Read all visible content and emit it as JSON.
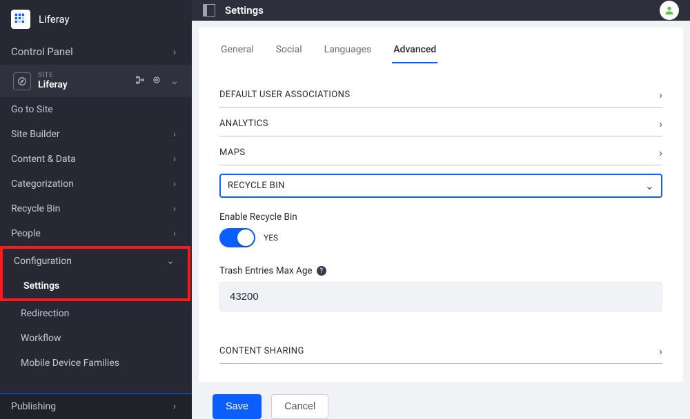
{
  "brand": {
    "name": "Liferay"
  },
  "sidebar": {
    "control_panel": "Control Panel",
    "site": {
      "kicker": "SITE",
      "name": "Liferay"
    },
    "go_to_site": "Go to Site",
    "items": [
      {
        "label": "Site Builder"
      },
      {
        "label": "Content & Data"
      },
      {
        "label": "Categorization"
      },
      {
        "label": "Recycle Bin"
      },
      {
        "label": "People"
      }
    ],
    "configuration": {
      "label": "Configuration",
      "children": [
        {
          "label": "Settings",
          "active": true
        },
        {
          "label": "Redirection"
        },
        {
          "label": "Workflow"
        },
        {
          "label": "Mobile Device Families"
        }
      ]
    },
    "publishing": "Publishing"
  },
  "header": {
    "title": "Settings"
  },
  "tabs": {
    "general": "General",
    "social": "Social",
    "languages": "Languages",
    "advanced": "Advanced"
  },
  "sections": {
    "default_user_assoc": "DEFAULT USER ASSOCIATIONS",
    "analytics": "ANALYTICS",
    "maps": "MAPS",
    "recycle": "RECYCLE BIN",
    "content_sharing": "CONTENT SHARING"
  },
  "recycle": {
    "enable_label": "Enable Recycle Bin",
    "toggle_text": "YES",
    "max_age_label": "Trash Entries Max Age",
    "max_age_value": "43200"
  },
  "actions": {
    "save": "Save",
    "cancel": "Cancel"
  }
}
